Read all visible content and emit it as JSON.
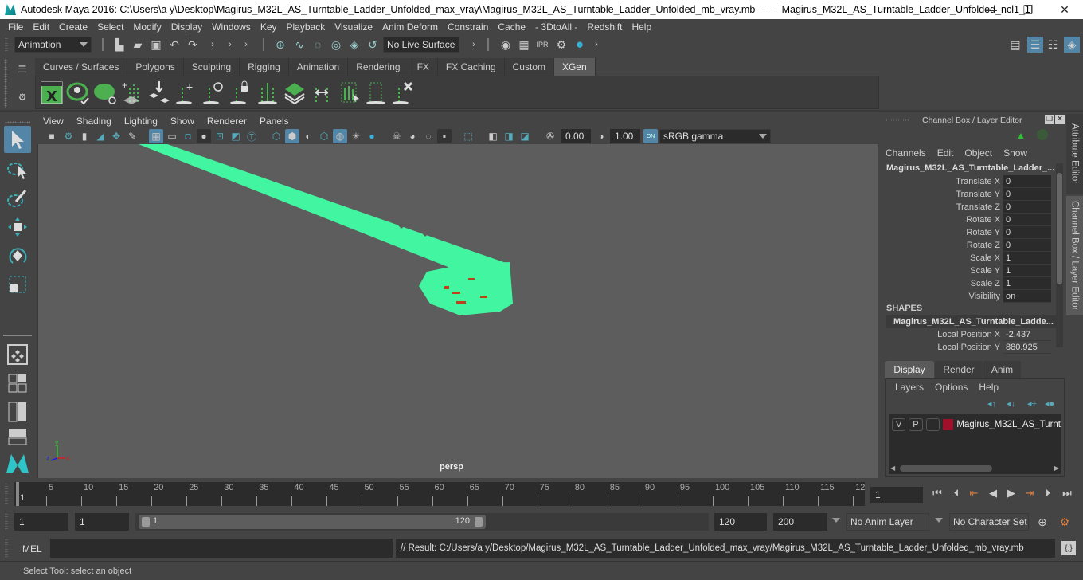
{
  "window": {
    "title": "Autodesk Maya 2016: C:\\Users\\a y\\Desktop\\Magirus_M32L_AS_Turntable_Ladder_Unfolded_max_vray\\Magirus_M32L_AS_Turntable_Ladder_Unfolded_mb_vray.mb   ---   Magirus_M32L_AS_Turntable_Ladder_Unfolded_ncl1_1",
    "minimize": "—",
    "restore": "❐",
    "close": "✕"
  },
  "menu": [
    "File",
    "Edit",
    "Create",
    "Select",
    "Modify",
    "Display",
    "Windows",
    "Key",
    "Playback",
    "Visualize",
    "Anim Deform",
    "Constrain",
    "Cache",
    "- 3DtoAll -",
    "Redshift",
    "Help"
  ],
  "status_toolbar": {
    "menuset": "Animation",
    "live_surface": "No Live Surface"
  },
  "shelf": {
    "tabs": [
      "Curves / Surfaces",
      "Polygons",
      "Sculpting",
      "Rigging",
      "Animation",
      "Rendering",
      "FX",
      "FX Caching",
      "Custom",
      "XGen"
    ],
    "active_tab": "XGen",
    "icons": [
      "xgen-editor-icon",
      "toggle-preview-icon",
      "hide-preview-icon",
      "add-primitives-icon",
      "place-guides-icon",
      "add-guide-icon",
      "show-guides-icon",
      "lock-guides-icon",
      "guide-split-icon",
      "patch-icon",
      "sculpt-guides-icon",
      "select-guides-icon",
      "guide-bounds-icon",
      "delete-guide-icon"
    ]
  },
  "left_tools": [
    "select-tool",
    "lasso-tool",
    "paint-select-tool",
    "move-tool",
    "rotate-tool",
    "scale-tool"
  ],
  "viewport": {
    "menu": [
      "View",
      "Shading",
      "Lighting",
      "Show",
      "Renderer",
      "Panels"
    ],
    "exposure": "0.00",
    "gamma": "1.00",
    "color_mgmt_badge": "ON",
    "color_space": "sRGB gamma",
    "camera_label": "persp",
    "axis_labels": {
      "x": "x",
      "y": "y",
      "z": "z"
    },
    "mesh_color": "#42f5a0"
  },
  "channel_box": {
    "header": "Channel Box / Layer Editor",
    "menu": [
      "Channels",
      "Edit",
      "Object",
      "Show"
    ],
    "object_name": "Magirus_M32L_AS_Turntable_Ladder_...",
    "channels": [
      {
        "label": "Translate X",
        "value": "0"
      },
      {
        "label": "Translate Y",
        "value": "0"
      },
      {
        "label": "Translate Z",
        "value": "0"
      },
      {
        "label": "Rotate X",
        "value": "0"
      },
      {
        "label": "Rotate Y",
        "value": "0"
      },
      {
        "label": "Rotate Z",
        "value": "0"
      },
      {
        "label": "Scale X",
        "value": "1"
      },
      {
        "label": "Scale Y",
        "value": "1"
      },
      {
        "label": "Scale Z",
        "value": "1"
      },
      {
        "label": "Visibility",
        "value": "on"
      }
    ],
    "shapes_header": "SHAPES",
    "shape_name": "Magirus_M32L_AS_Turntable_Ladde...",
    "shape_channels": [
      {
        "label": "Local Position X",
        "value": "-2.437"
      },
      {
        "label": "Local Position Y",
        "value": "880.925"
      }
    ]
  },
  "side_tabs": {
    "attribute_editor": "Attribute Editor",
    "channel_box": "Channel Box / Layer Editor"
  },
  "layer_editor": {
    "tabs": [
      "Display",
      "Render",
      "Anim"
    ],
    "active_tab": "Display",
    "menu": [
      "Layers",
      "Options",
      "Help"
    ],
    "layers": [
      {
        "v": "V",
        "p": "P",
        "color": "#a0102a",
        "name": "Magirus_M32L_AS_Turnt"
      }
    ]
  },
  "timeline": {
    "ticks": [
      "5",
      "10",
      "15",
      "20",
      "25",
      "30",
      "35",
      "40",
      "45",
      "50",
      "55",
      "60",
      "65",
      "70",
      "75",
      "80",
      "85",
      "90",
      "95",
      "100",
      "105",
      "110",
      "115",
      "12"
    ],
    "current_frame_marker": "1",
    "current_frame": "1"
  },
  "range": {
    "start": "1",
    "playback_start": "1",
    "slider_start": "1",
    "slider_end": "120",
    "playback_end": "120",
    "end": "200",
    "anim_layer": "No Anim Layer",
    "character_set": "No Character Set"
  },
  "command_line": {
    "label": "MEL",
    "input": "",
    "result": "// Result: C:/Users/a y/Desktop/Magirus_M32L_AS_Turntable_Ladder_Unfolded_max_vray/Magirus_M32L_AS_Turntable_Ladder_Unfolded_mb_vray.mb"
  },
  "help_line": "Select Tool: select an object"
}
